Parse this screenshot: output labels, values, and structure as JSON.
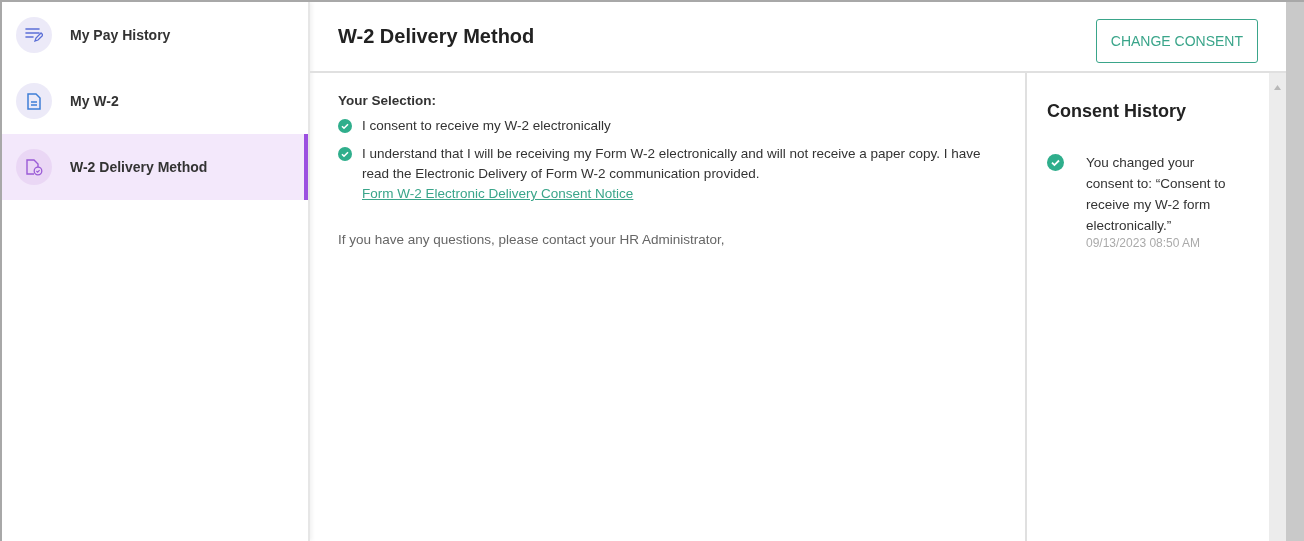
{
  "sidebar": {
    "items": [
      {
        "label": "My Pay History",
        "kind": "pay",
        "selected": false
      },
      {
        "label": "My W-2",
        "kind": "document",
        "selected": false
      },
      {
        "label": "W-2 Delivery Method",
        "kind": "delivery",
        "selected": true
      }
    ]
  },
  "header": {
    "title": "W-2 Delivery Method",
    "button": "CHANGE CONSENT"
  },
  "selection": {
    "heading": "Your Selection:",
    "items": [
      {
        "text": "I consent to receive my W-2 electronically",
        "checked": true
      },
      {
        "text": "I understand that I will be receiving my Form W-2 electronically and will not receive a paper copy. I have read the Electronic Delivery of Form W-2 communication provided.",
        "link": "Form W-2 Electronic Delivery Consent Notice",
        "checked": true
      }
    ],
    "note": "If you have any questions, please contact your HR Administrator,"
  },
  "history": {
    "title": "Consent History",
    "entries": [
      {
        "text": "You changed your consent to: “Consent to receive my W-2 form electronically.”",
        "time": "09/13/2023 08:50 AM",
        "checked": true
      }
    ]
  }
}
